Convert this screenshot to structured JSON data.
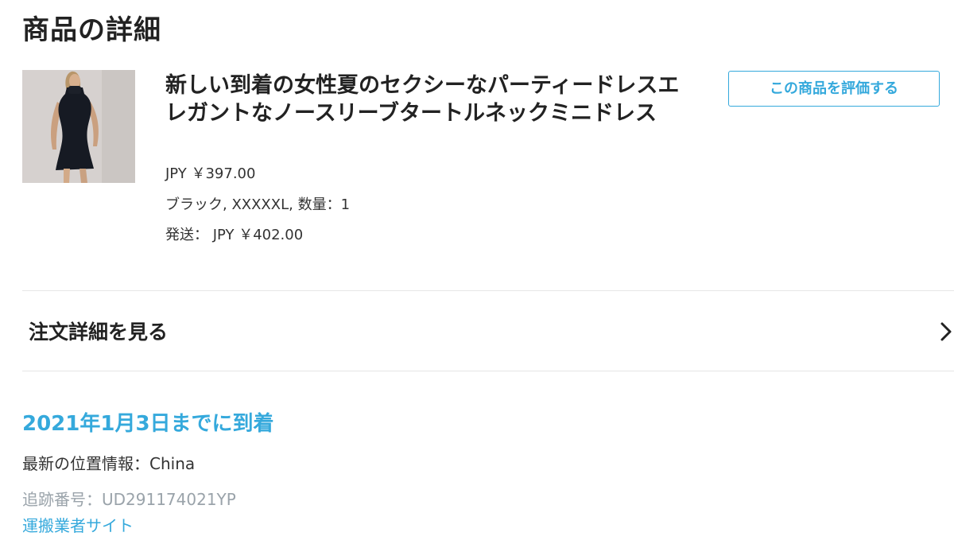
{
  "page": {
    "title": "商品の詳細"
  },
  "product": {
    "image_alt": "black sleeveless turtleneck mini dress",
    "title": "新しい到着の女性夏のセクシーなパーティードレスエレガントなノースリーブタートルネックミニドレス",
    "price": "JPY ￥397.00",
    "variant": "ブラック, XXXXXL, 数量：1",
    "shipping": "発送： JPY ￥402.00",
    "review_button_label": "この商品を評価する"
  },
  "order": {
    "details_label": "注文詳細を見る",
    "icon": "chevron-right-icon"
  },
  "delivery": {
    "arrival": "2021年1月3日までに到着",
    "latest_location": "最新の位置情報：China",
    "tracking_number": "追跡番号：UD291174021YP",
    "carrier_link": "運搬業者サイト"
  },
  "colors": {
    "accent": "#35a9dc",
    "text": "#222222",
    "muted": "#9aa3aa",
    "divider": "#e6e6e6"
  }
}
